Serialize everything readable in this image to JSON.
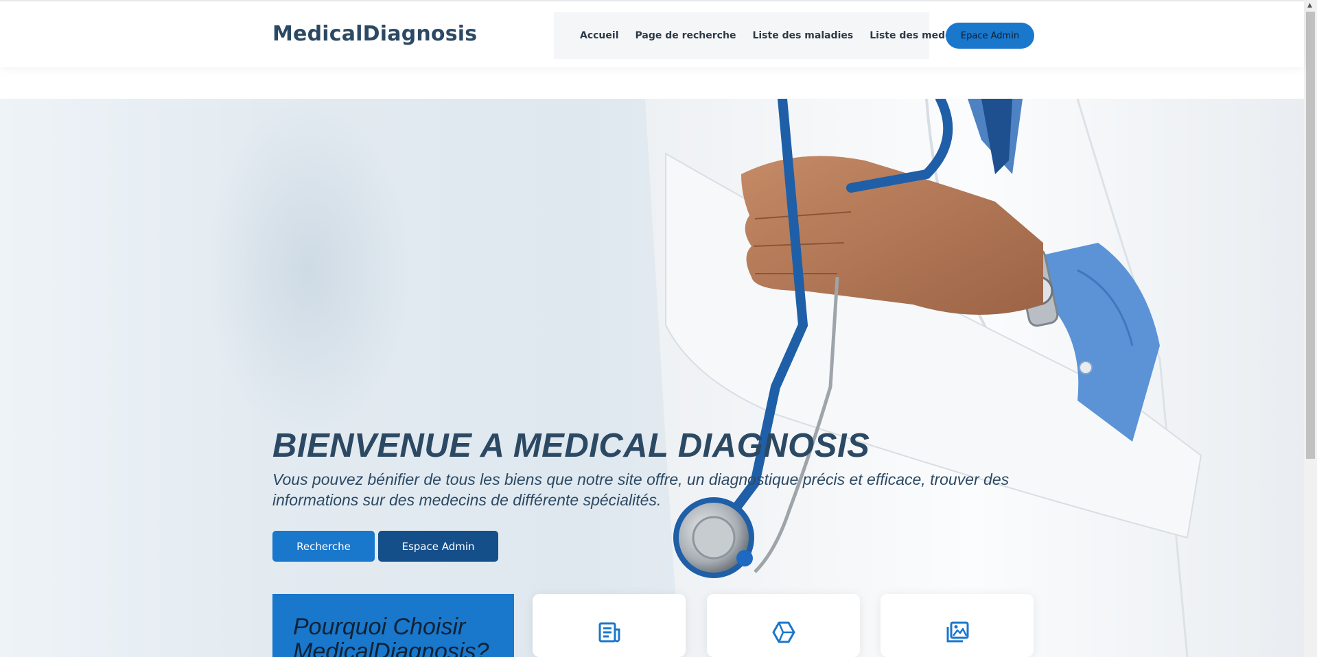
{
  "header": {
    "logo": "MedicalDiagnosis",
    "nav": [
      {
        "label": "Accueil"
      },
      {
        "label": "Page de recherche"
      },
      {
        "label": "Liste des maladies"
      },
      {
        "label": "Liste des medecins"
      }
    ],
    "admin_button": "Epace Admin"
  },
  "hero": {
    "title": "BIENVENUE A MEDICAL DIAGNOSIS",
    "text": "Vous pouvez bénifier de tous les biens que notre site offre, un diagnostique précis et efficace, trouver des informations sur des medecins de différente spécialités.",
    "buttons": {
      "search": "Recherche",
      "admin": "Espace Admin"
    }
  },
  "why": {
    "title": "Pourquoi Choisir MedicalDiagnosis?"
  },
  "cards": [
    {
      "icon": "receipt-icon"
    },
    {
      "icon": "cube-icon"
    },
    {
      "icon": "images-icon"
    }
  ],
  "colors": {
    "primary": "#1977cc",
    "dark_blue": "#154f8a",
    "text": "#2c4964"
  }
}
